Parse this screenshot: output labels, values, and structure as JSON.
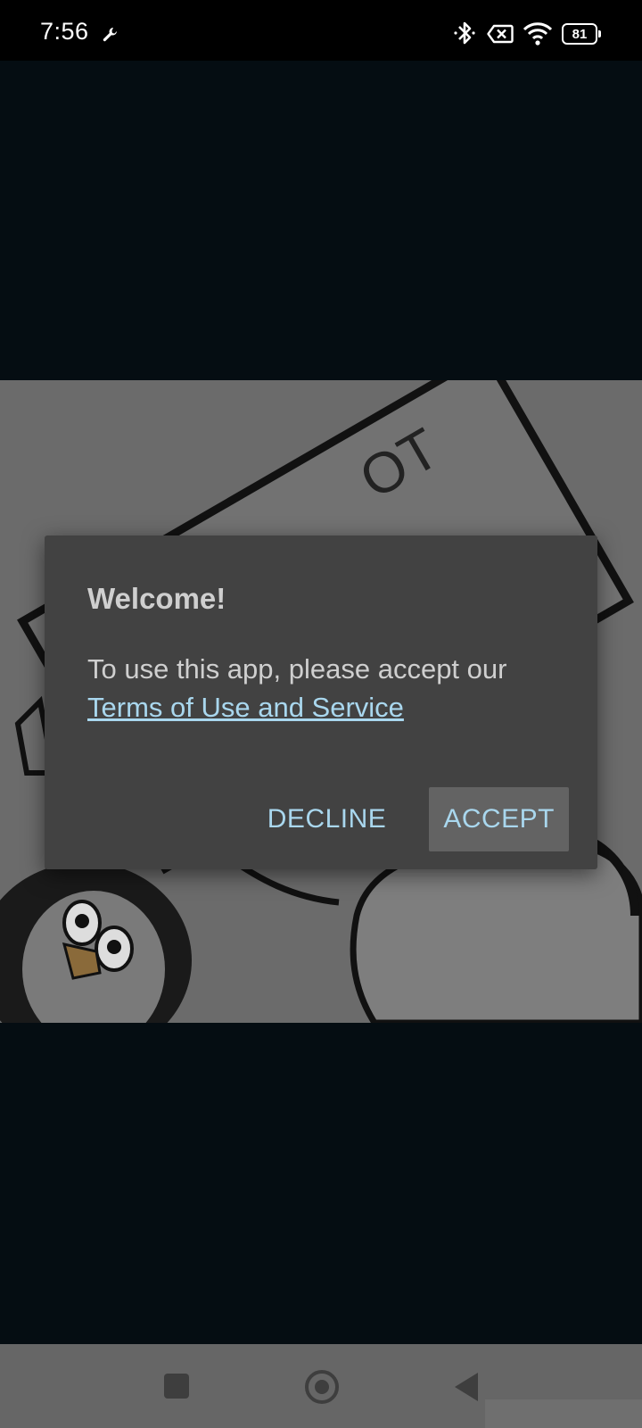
{
  "status_bar": {
    "time": "7:56",
    "battery_level": "81",
    "icons": [
      "wrench-icon",
      "bluetooth-icon",
      "no-sim-icon",
      "wifi-icon",
      "battery-icon"
    ]
  },
  "artwork": {
    "sign_text": "OT"
  },
  "dialog": {
    "title": "Welcome!",
    "body": "To use this app, please accept our",
    "link": "Terms of Use and Service",
    "decline_label": "DECLINE",
    "accept_label": "ACCEPT"
  },
  "nav_bar": {
    "icons": [
      "recent-apps-icon",
      "home-icon",
      "back-icon"
    ]
  },
  "colors": {
    "background": "#050d12",
    "dialog_background": "#424242",
    "accent": "#a9d7ee",
    "dialog_text": "#cfcfcf"
  }
}
